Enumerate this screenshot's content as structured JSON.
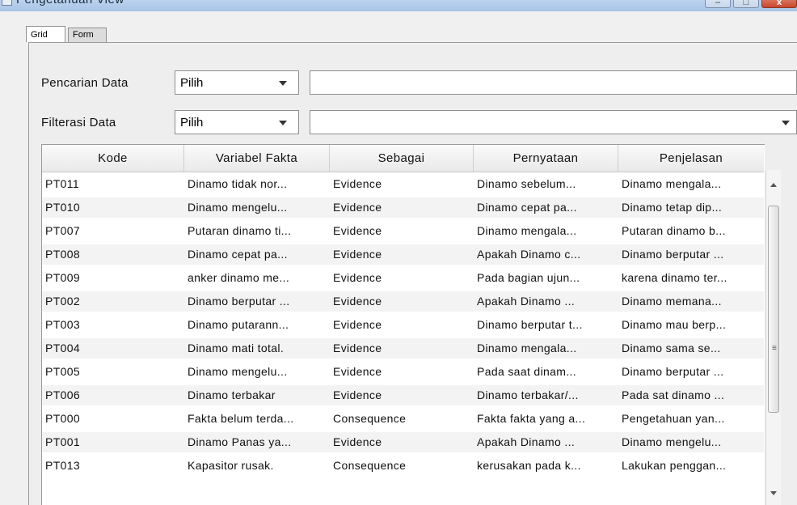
{
  "window": {
    "title": "Pengetahuan View"
  },
  "tabs": [
    {
      "label": "Grid",
      "active": true
    },
    {
      "label": "Form",
      "active": false
    }
  ],
  "search": {
    "label": "Pencarian Data",
    "select_value": "Pilih",
    "input_value": ""
  },
  "filter": {
    "label": "Filterasi Data",
    "select_value": "Pilih",
    "input_value": ""
  },
  "table": {
    "columns": [
      "Kode",
      "Variabel Fakta",
      "Sebagai",
      "Pernyataan",
      "Penjelasan"
    ],
    "rows": [
      [
        "PT011",
        "Dinamo tidak nor...",
        "Evidence",
        "Dinamo sebelum...",
        "Dinamo mengala..."
      ],
      [
        "PT010",
        "Dinamo mengelu...",
        "Evidence",
        "Dinamo cepat pa...",
        "Dinamo tetap dip..."
      ],
      [
        "PT007",
        "Putaran dinamo ti...",
        "Evidence",
        "Dinamo mengala...",
        "Putaran dinamo b..."
      ],
      [
        "PT008",
        "Dinamo cepat pa...",
        "Evidence",
        "Apakah Dinamo c...",
        "Dinamo berputar ..."
      ],
      [
        "PT009",
        "anker dinamo me...",
        "Evidence",
        "Pada bagian ujun...",
        "karena dinamo ter..."
      ],
      [
        "PT002",
        "Dinamo berputar ...",
        "Evidence",
        "Apakah Dinamo ...",
        "Dinamo memana..."
      ],
      [
        "PT003",
        "Dinamo putarann...",
        "Evidence",
        "Dinamo berputar t...",
        "Dinamo mau berp..."
      ],
      [
        "PT004",
        "Dinamo mati total.",
        "Evidence",
        "Dinamo mengala...",
        "Dinamo sama se..."
      ],
      [
        "PT005",
        "Dinamo mengelu...",
        "Evidence",
        "Pada saat dinam...",
        "Dinamo berputar ..."
      ],
      [
        "PT006",
        "Dinamo terbakar",
        "Evidence",
        "Dinamo terbakar/...",
        "Pada sat dinamo ..."
      ],
      [
        "PT000",
        "Fakta belum terda...",
        "Consequence",
        "Fakta fakta yang a...",
        "Pengetahuan yan..."
      ],
      [
        "PT001",
        "Dinamo Panas ya...",
        "Evidence",
        "Apakah Dinamo ...",
        "Dinamo mengelu..."
      ],
      [
        "PT013",
        "Kapasitor rusak.",
        "Consequence",
        "kerusakan pada k...",
        "Lakukan penggan..."
      ]
    ]
  },
  "icons": {
    "window_icon": "app-window-icon",
    "dropdown": "chevron-down-icon",
    "scroll_up": "scroll-up-arrow-icon",
    "scroll_down": "scroll-down-arrow-icon",
    "scroll_grip": "grip-icon"
  }
}
